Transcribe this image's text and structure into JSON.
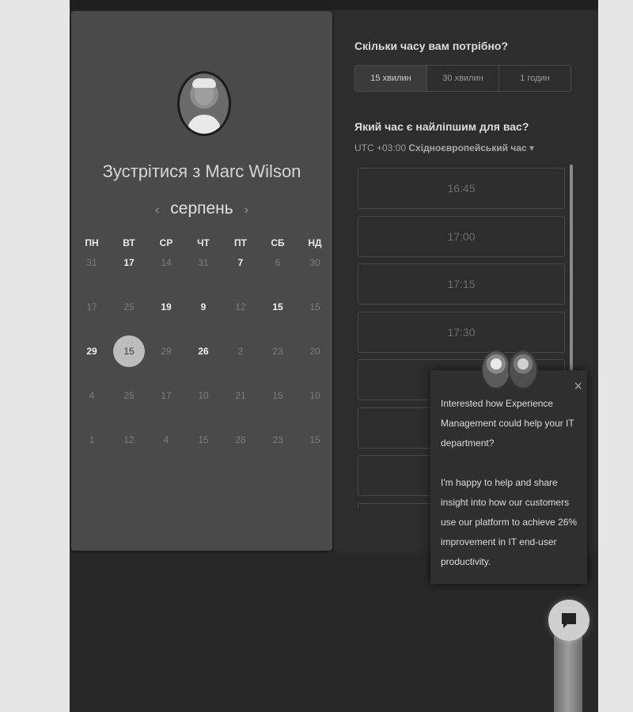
{
  "host": {
    "meet_title": "Зустрітися з Marc Wilson",
    "month": "серпень"
  },
  "calendar": {
    "weekdays": [
      "ПН",
      "ВТ",
      "СР",
      "ЧТ",
      "ПТ",
      "СБ",
      "НД"
    ],
    "weeks": [
      [
        {
          "d": "31",
          "b": false
        },
        {
          "d": "17",
          "b": true
        },
        {
          "d": "14",
          "b": false
        },
        {
          "d": "31",
          "b": false
        },
        {
          "d": "7",
          "b": true
        },
        {
          "d": "6",
          "b": false
        },
        {
          "d": "30",
          "b": false
        }
      ],
      [
        {
          "d": "17",
          "b": false
        },
        {
          "d": "25",
          "b": false
        },
        {
          "d": "19",
          "b": true
        },
        {
          "d": "9",
          "b": true
        },
        {
          "d": "12",
          "b": false
        },
        {
          "d": "15",
          "b": true
        },
        {
          "d": "15",
          "b": false
        }
      ],
      [
        {
          "d": "29",
          "b": true
        },
        {
          "d": "15",
          "b": false,
          "selected": true
        },
        {
          "d": "29",
          "b": false
        },
        {
          "d": "26",
          "b": true
        },
        {
          "d": "2",
          "b": false
        },
        {
          "d": "23",
          "b": false
        },
        {
          "d": "20",
          "b": false
        }
      ],
      [
        {
          "d": "4",
          "b": false
        },
        {
          "d": "25",
          "b": false
        },
        {
          "d": "17",
          "b": false
        },
        {
          "d": "10",
          "b": false
        },
        {
          "d": "21",
          "b": false
        },
        {
          "d": "15",
          "b": false
        },
        {
          "d": "10",
          "b": false
        }
      ],
      [
        {
          "d": "1",
          "b": false
        },
        {
          "d": "12",
          "b": false
        },
        {
          "d": "4",
          "b": false
        },
        {
          "d": "15",
          "b": false
        },
        {
          "d": "28",
          "b": false
        },
        {
          "d": "23",
          "b": false
        },
        {
          "d": "15",
          "b": false
        }
      ]
    ]
  },
  "booking": {
    "duration_question": "Скільки часу вам потрібно?",
    "durations": [
      "15 хвилин",
      "30 хвилин",
      "1 годин"
    ],
    "time_question": "Який час є найліпшим для вас?",
    "tz_offset": "UTC +03:00",
    "tz_name": "Східноєвропейський час",
    "slots": [
      "16:45",
      "17:00",
      "17:15",
      "17:30",
      "",
      "",
      "",
      ""
    ]
  },
  "chat": {
    "para1": "Interested how Experience Management could help your IT department?",
    "para2": "I'm happy to help and share insight into how our customers use our platform to achieve 26% improvement in IT end-user productivity.",
    "close_icon": "×"
  }
}
